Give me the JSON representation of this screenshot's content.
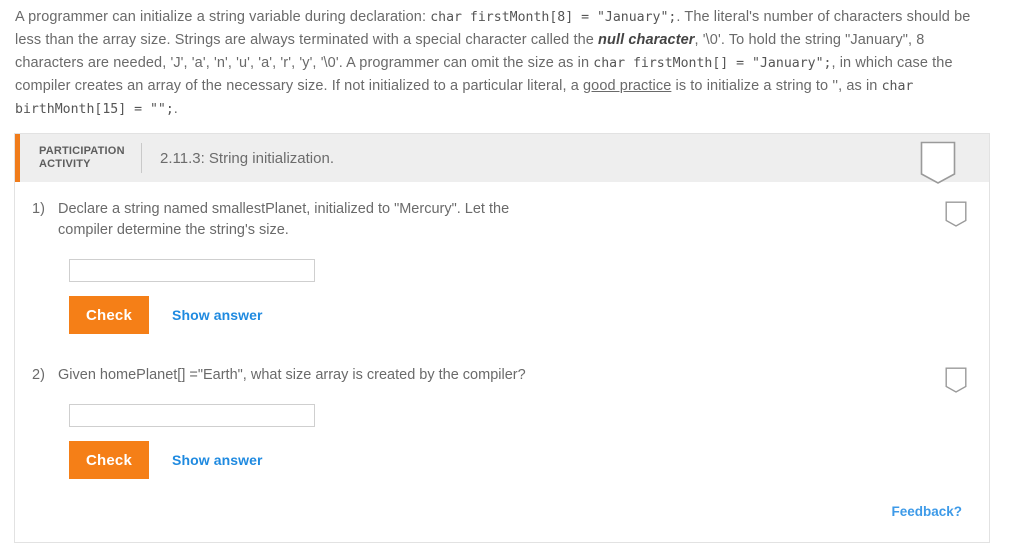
{
  "prose": {
    "seg1": "A programmer can initialize a string variable during declaration: ",
    "code1": "char firstMonth[8] = \"January\";",
    "seg2": ". The literal's number of characters should be less than the array size. Strings are always terminated with a special character called the ",
    "bold1": "null character",
    "seg3": ", '\\0'. To hold the string \"January\", 8 characters are needed, 'J', 'a', 'n', 'u', 'a', 'r', 'y', '\\0'. A programmer can omit the size as in ",
    "code2": "char firstMonth[] = \"January\";",
    "seg4": ", in which case the compiler creates an array of the necessary size. If not initialized to a particular literal, a ",
    "link1": "good practice",
    "seg5": " is to initialize a string to '', as in ",
    "code3": "char birthMonth[15] = \"\";",
    "seg6": "."
  },
  "activity": {
    "label_line1": "PARTICIPATION",
    "label_line2": "ACTIVITY",
    "title": "2.11.3: String initialization.",
    "header_icon": "pennant-icon",
    "accent_color": "#f07c1b",
    "questions": [
      {
        "number": "1)",
        "text": "Declare a string named smallestPlanet, initialized to \"Mercury\". Let the compiler determine the string's size.",
        "input_value": "",
        "input_placeholder": "",
        "check_label": "Check",
        "show_answer_label": "Show answer",
        "icon": "pennant-icon"
      },
      {
        "number": "2)",
        "text": "Given homePlanet[] =\"Earth\", what size array is created by the compiler?",
        "input_value": "",
        "input_placeholder": "",
        "check_label": "Check",
        "show_answer_label": "Show answer",
        "icon": "pennant-icon"
      }
    ],
    "feedback_label": "Feedback?"
  },
  "colors": {
    "check_button": "#f57f17",
    "link_blue": "#1f8ae0",
    "feedback_blue": "#3d9ae8",
    "header_bg": "#eeeeee",
    "body_text": "#6a6a6a"
  }
}
